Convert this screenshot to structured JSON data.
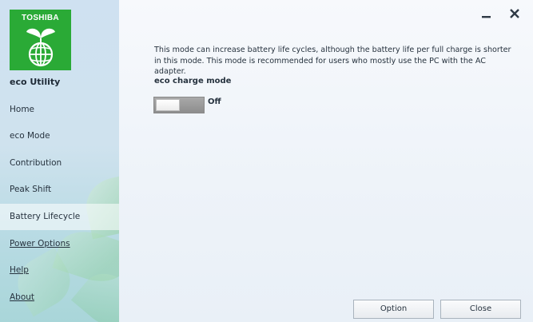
{
  "logo": {
    "brand_text": "TOSHIBA",
    "icon": "eco-globe-sprout-icon",
    "color": "#2aaa36"
  },
  "app_title": "eco Utility",
  "sidebar": {
    "items": [
      {
        "label": "Home",
        "selected": false,
        "link": false
      },
      {
        "label": "eco Mode",
        "selected": false,
        "link": false
      },
      {
        "label": "Contribution",
        "selected": false,
        "link": false
      },
      {
        "label": "Peak Shift",
        "selected": false,
        "link": false
      },
      {
        "label": "Battery Lifecycle",
        "selected": true,
        "link": false
      },
      {
        "label": "Power Options",
        "selected": false,
        "link": true
      },
      {
        "label": "Help",
        "selected": false,
        "link": true
      },
      {
        "label": "About",
        "selected": false,
        "link": true
      }
    ]
  },
  "window_controls": {
    "minimize_icon": "minimize-icon",
    "close_icon": "close-icon"
  },
  "main": {
    "description": "This mode can increase battery life cycles, although the battery life per full charge is shorter in this mode. This mode is recommended for users who mostly use the PC with the AC adapter.",
    "section_label": "eco charge mode",
    "toggle": {
      "state_label": "Off",
      "on": false
    }
  },
  "footer": {
    "option_label": "Option",
    "close_label": "Close"
  }
}
